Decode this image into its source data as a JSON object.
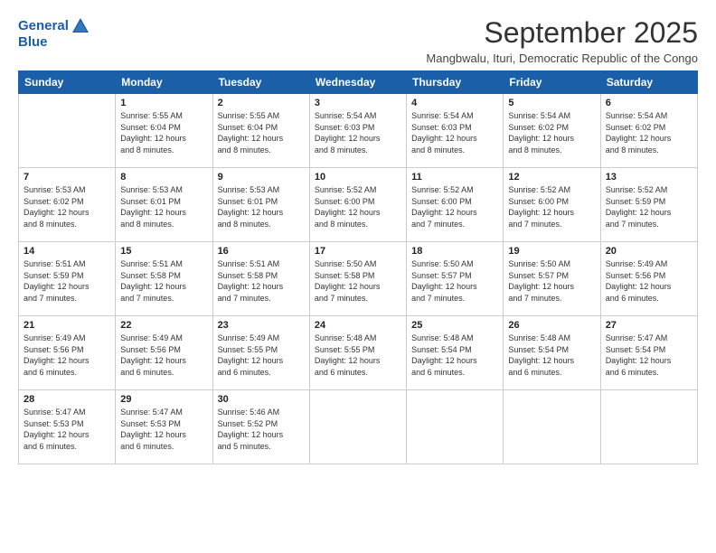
{
  "logo": {
    "line1": "General",
    "line2": "Blue"
  },
  "title": "September 2025",
  "subtitle": "Mangbwalu, Ituri, Democratic Republic of the Congo",
  "days_of_week": [
    "Sunday",
    "Monday",
    "Tuesday",
    "Wednesday",
    "Thursday",
    "Friday",
    "Saturday"
  ],
  "weeks": [
    [
      {
        "day": "",
        "info": ""
      },
      {
        "day": "1",
        "info": "Sunrise: 5:55 AM\nSunset: 6:04 PM\nDaylight: 12 hours\nand 8 minutes."
      },
      {
        "day": "2",
        "info": "Sunrise: 5:55 AM\nSunset: 6:04 PM\nDaylight: 12 hours\nand 8 minutes."
      },
      {
        "day": "3",
        "info": "Sunrise: 5:54 AM\nSunset: 6:03 PM\nDaylight: 12 hours\nand 8 minutes."
      },
      {
        "day": "4",
        "info": "Sunrise: 5:54 AM\nSunset: 6:03 PM\nDaylight: 12 hours\nand 8 minutes."
      },
      {
        "day": "5",
        "info": "Sunrise: 5:54 AM\nSunset: 6:02 PM\nDaylight: 12 hours\nand 8 minutes."
      },
      {
        "day": "6",
        "info": "Sunrise: 5:54 AM\nSunset: 6:02 PM\nDaylight: 12 hours\nand 8 minutes."
      }
    ],
    [
      {
        "day": "7",
        "info": "Sunrise: 5:53 AM\nSunset: 6:02 PM\nDaylight: 12 hours\nand 8 minutes."
      },
      {
        "day": "8",
        "info": "Sunrise: 5:53 AM\nSunset: 6:01 PM\nDaylight: 12 hours\nand 8 minutes."
      },
      {
        "day": "9",
        "info": "Sunrise: 5:53 AM\nSunset: 6:01 PM\nDaylight: 12 hours\nand 8 minutes."
      },
      {
        "day": "10",
        "info": "Sunrise: 5:52 AM\nSunset: 6:00 PM\nDaylight: 12 hours\nand 8 minutes."
      },
      {
        "day": "11",
        "info": "Sunrise: 5:52 AM\nSunset: 6:00 PM\nDaylight: 12 hours\nand 7 minutes."
      },
      {
        "day": "12",
        "info": "Sunrise: 5:52 AM\nSunset: 6:00 PM\nDaylight: 12 hours\nand 7 minutes."
      },
      {
        "day": "13",
        "info": "Sunrise: 5:52 AM\nSunset: 5:59 PM\nDaylight: 12 hours\nand 7 minutes."
      }
    ],
    [
      {
        "day": "14",
        "info": "Sunrise: 5:51 AM\nSunset: 5:59 PM\nDaylight: 12 hours\nand 7 minutes."
      },
      {
        "day": "15",
        "info": "Sunrise: 5:51 AM\nSunset: 5:58 PM\nDaylight: 12 hours\nand 7 minutes."
      },
      {
        "day": "16",
        "info": "Sunrise: 5:51 AM\nSunset: 5:58 PM\nDaylight: 12 hours\nand 7 minutes."
      },
      {
        "day": "17",
        "info": "Sunrise: 5:50 AM\nSunset: 5:58 PM\nDaylight: 12 hours\nand 7 minutes."
      },
      {
        "day": "18",
        "info": "Sunrise: 5:50 AM\nSunset: 5:57 PM\nDaylight: 12 hours\nand 7 minutes."
      },
      {
        "day": "19",
        "info": "Sunrise: 5:50 AM\nSunset: 5:57 PM\nDaylight: 12 hours\nand 7 minutes."
      },
      {
        "day": "20",
        "info": "Sunrise: 5:49 AM\nSunset: 5:56 PM\nDaylight: 12 hours\nand 6 minutes."
      }
    ],
    [
      {
        "day": "21",
        "info": "Sunrise: 5:49 AM\nSunset: 5:56 PM\nDaylight: 12 hours\nand 6 minutes."
      },
      {
        "day": "22",
        "info": "Sunrise: 5:49 AM\nSunset: 5:56 PM\nDaylight: 12 hours\nand 6 minutes."
      },
      {
        "day": "23",
        "info": "Sunrise: 5:49 AM\nSunset: 5:55 PM\nDaylight: 12 hours\nand 6 minutes."
      },
      {
        "day": "24",
        "info": "Sunrise: 5:48 AM\nSunset: 5:55 PM\nDaylight: 12 hours\nand 6 minutes."
      },
      {
        "day": "25",
        "info": "Sunrise: 5:48 AM\nSunset: 5:54 PM\nDaylight: 12 hours\nand 6 minutes."
      },
      {
        "day": "26",
        "info": "Sunrise: 5:48 AM\nSunset: 5:54 PM\nDaylight: 12 hours\nand 6 minutes."
      },
      {
        "day": "27",
        "info": "Sunrise: 5:47 AM\nSunset: 5:54 PM\nDaylight: 12 hours\nand 6 minutes."
      }
    ],
    [
      {
        "day": "28",
        "info": "Sunrise: 5:47 AM\nSunset: 5:53 PM\nDaylight: 12 hours\nand 6 minutes."
      },
      {
        "day": "29",
        "info": "Sunrise: 5:47 AM\nSunset: 5:53 PM\nDaylight: 12 hours\nand 6 minutes."
      },
      {
        "day": "30",
        "info": "Sunrise: 5:46 AM\nSunset: 5:52 PM\nDaylight: 12 hours\nand 5 minutes."
      },
      {
        "day": "",
        "info": ""
      },
      {
        "day": "",
        "info": ""
      },
      {
        "day": "",
        "info": ""
      },
      {
        "day": "",
        "info": ""
      }
    ]
  ]
}
